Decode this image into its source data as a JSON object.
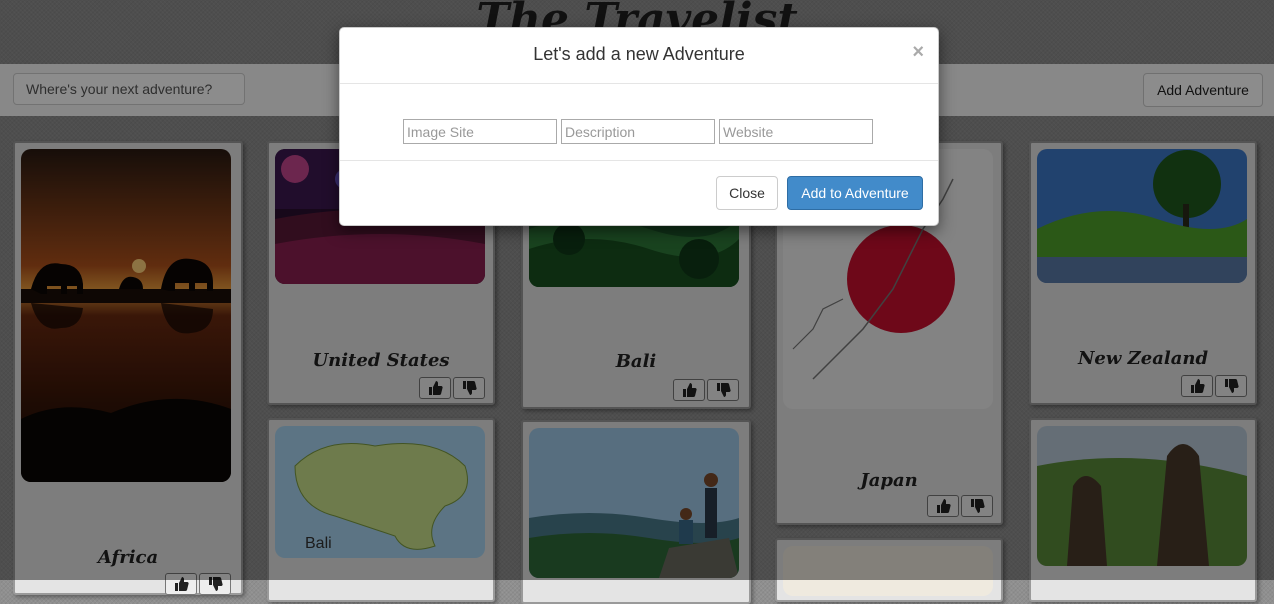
{
  "header": {
    "title": "The Travelist"
  },
  "toolbar": {
    "search_placeholder": "Where's your next adventure?",
    "add_label": "Add Adventure"
  },
  "cards": [
    {
      "label": "Africa",
      "photo": "elephants-sunset-photo"
    },
    {
      "label": "United States",
      "photo": "concert-crowd-photo"
    },
    {
      "label": "Bali",
      "photo": "rice-terraces-photo"
    },
    {
      "label": "Japan",
      "photo": "japan-flag-map-photo"
    },
    {
      "label": "New Zealand",
      "photo": "green-hills-lake-photo"
    },
    {
      "label": "",
      "photo": "bali-map-photo"
    },
    {
      "label": "",
      "photo": "hikers-overlook-photo"
    },
    {
      "label": "",
      "photo": "easter-island-moai-photo"
    }
  ],
  "bali_map_text": "Bali",
  "icons": {
    "like": "thumbs-up-icon",
    "dislike": "thumbs-down-icon"
  },
  "modal": {
    "title": "Let's add a new Adventure",
    "close_symbol": "×",
    "fields": {
      "image_site_placeholder": "Image Site",
      "description_placeholder": "Description",
      "website_placeholder": "Website"
    },
    "close_label": "Close",
    "submit_label": "Add to Adventure"
  },
  "colors": {
    "primary": "#428bca",
    "overlay": "rgba(0,0,0,0.45)"
  }
}
